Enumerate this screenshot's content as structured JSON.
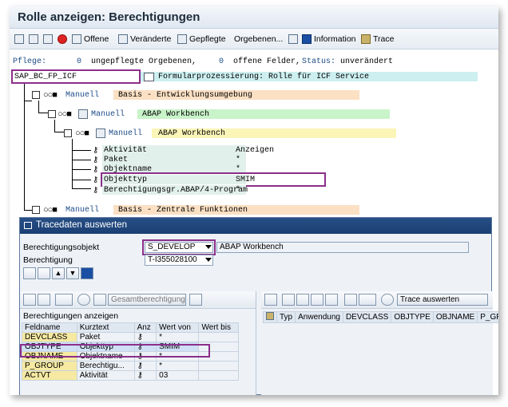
{
  "window": {
    "title": "Rolle anzeigen: Berechtigungen"
  },
  "toolbar": {
    "items": [
      {
        "label": "Offene",
        "icon": "open-icon"
      },
      {
        "label": "Veränderte",
        "icon": "changed-icon"
      },
      {
        "label": "Gepflegte",
        "icon": "maintained-icon"
      },
      {
        "label": "Orgebenen...",
        "icon": ""
      },
      {
        "label": "Information",
        "icon": "info-icon"
      },
      {
        "label": "Trace",
        "icon": "trace-icon"
      }
    ]
  },
  "status": {
    "pflege_label": "Pflege:",
    "unmaintained_count": "0",
    "unmaintained_label": "ungepflegte Orgebenen,",
    "open_count": "0",
    "open_label": "offene Felder,",
    "status_label": "Status:",
    "status_value": "unverändert"
  },
  "tree": {
    "root_name": "SAP_BC_FP_ICF",
    "root_desc": "Formularprozessierung: Rolle für ICF Service",
    "nodes": [
      {
        "type": "Manuell",
        "desc": "Basis - Entwicklungsumgebung"
      },
      {
        "type": "Manuell",
        "desc": "ABAP Workbench"
      },
      {
        "type": "Manuell",
        "desc": "ABAP Workbench"
      }
    ],
    "fields": [
      {
        "name": "Aktivität",
        "value": "Anzeigen"
      },
      {
        "name": "Paket",
        "value": "*"
      },
      {
        "name": "Objektname",
        "value": "*"
      },
      {
        "name": "Objekttyp",
        "value": "SMIM"
      },
      {
        "name": "Berechtigungsgr.ABAP/4-Program",
        "value": "*"
      }
    ],
    "last_node": {
      "type": "Manuell",
      "desc": "Basis - Zentrale Funktionen"
    }
  },
  "dialog": {
    "title": "Tracedaten auswerten",
    "auth_object_label": "Berechtigungsobjekt",
    "auth_object_value": "S_DEVELOP",
    "auth_object_desc": "ABAP Workbench",
    "auth_label": "Berechtigung",
    "auth_value": "T-I355028100",
    "left_panel": {
      "button_label": "Gesamtberechtigung",
      "title": "Berechtigungen anzeigen",
      "headers": [
        "Feldname",
        "Kurztext",
        "Anz",
        "Wert von",
        "Wert bis"
      ],
      "rows": [
        {
          "field": "DEVCLASS",
          "text": "Paket",
          "from": "*",
          "to": ""
        },
        {
          "field": "OBJTYPE",
          "text": "Objekttyp",
          "from": "SMIM",
          "to": ""
        },
        {
          "field": "OBJNAME",
          "text": "Objektname",
          "from": "*",
          "to": ""
        },
        {
          "field": "P_GROUP",
          "text": "Berechtigu...",
          "from": "*",
          "to": ""
        },
        {
          "field": "ACTVT",
          "text": "Aktivität",
          "from": "03",
          "to": ""
        }
      ]
    },
    "right_panel": {
      "button_label": "Trace auswerten",
      "headers": [
        "Typ",
        "Anwendung",
        "DEVCLASS",
        "OBJTYPE",
        "OBJNAME",
        "P_GROUP"
      ]
    }
  },
  "colors": {
    "highlight": "#8b2f8b",
    "titlebar": "#1a3f73"
  }
}
